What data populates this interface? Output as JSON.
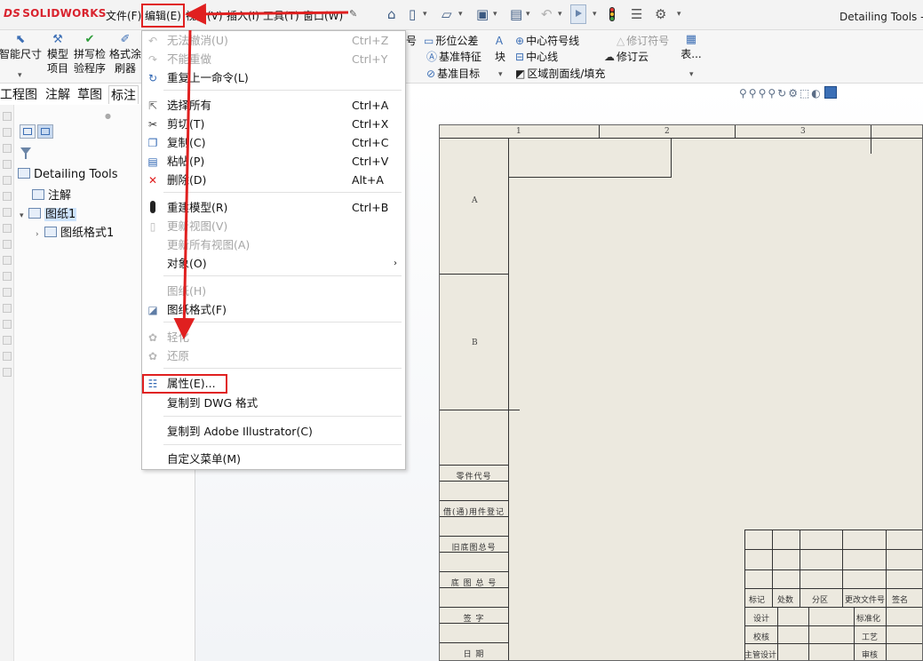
{
  "app": {
    "logo_ds": "DS",
    "logo": "SOLIDWORKS",
    "document_title": "Detailing Tools - 图"
  },
  "menubar": {
    "items": [
      "文件(F)",
      "编辑(E)",
      "视图(V)",
      "插入(I)",
      "工具(T)",
      "窗口(W)"
    ]
  },
  "ribbon": {
    "buttons": [
      {
        "label1": "智能尺寸",
        "label2": ""
      },
      {
        "label1": "模型",
        "label2": "项目"
      },
      {
        "label1": "拼写检",
        "label2": "验程序"
      },
      {
        "label1": "格式涂",
        "label2": "刷器"
      }
    ],
    "group_mid": [
      "号",
      "形位公差",
      "基准特征",
      "基准目标",
      "块"
    ],
    "group_center": [
      "中心符号线",
      "中心线",
      "区域剖面线/填充"
    ],
    "group_right": [
      "修订符号",
      "修订云",
      "表..."
    ]
  },
  "command_tabs": [
    "工程图",
    "注解",
    "草图",
    "标注"
  ],
  "tree": {
    "root": "Detailing Tools",
    "annotations": "注解",
    "sheet": "图纸1",
    "sheet_format": "图纸格式1"
  },
  "edit_menu": {
    "items": [
      {
        "label": "无法撤消(U)",
        "shortcut": "Ctrl+Z",
        "disabled": true
      },
      {
        "label": "不能重做",
        "shortcut": "Ctrl+Y",
        "disabled": true
      },
      {
        "label": "重复上一命令(L)",
        "shortcut": "",
        "disabled": false
      },
      {
        "label": "选择所有",
        "shortcut": "Ctrl+A",
        "disabled": false
      },
      {
        "label": "剪切(T)",
        "shortcut": "Ctrl+X",
        "disabled": false
      },
      {
        "label": "复制(C)",
        "shortcut": "Ctrl+C",
        "disabled": false
      },
      {
        "label": "粘帖(P)",
        "shortcut": "Ctrl+V",
        "disabled": false
      },
      {
        "label": "删除(D)",
        "shortcut": "Alt+A",
        "disabled": false
      },
      {
        "label": "重建模型(R)",
        "shortcut": "Ctrl+B",
        "disabled": false
      },
      {
        "label": "更新视图(V)",
        "shortcut": "",
        "disabled": true
      },
      {
        "label": "更新所有视图(A)",
        "shortcut": "",
        "disabled": true
      },
      {
        "label": "对象(O)",
        "shortcut": "",
        "disabled": false
      },
      {
        "label": "图纸(H)",
        "shortcut": "",
        "disabled": true
      },
      {
        "label": "图纸格式(F)",
        "shortcut": "",
        "disabled": false
      },
      {
        "label": "轻化",
        "shortcut": "",
        "disabled": true
      },
      {
        "label": "还原",
        "shortcut": "",
        "disabled": true
      },
      {
        "label": "属性(E)...",
        "shortcut": "",
        "disabled": false
      },
      {
        "label": "复制到 DWG 格式",
        "shortcut": "",
        "disabled": false
      },
      {
        "label": "复制到 Adobe Illustrator(C)",
        "shortcut": "",
        "disabled": false
      },
      {
        "label": "自定义菜单(M)",
        "shortcut": "",
        "disabled": false
      }
    ]
  },
  "drawing": {
    "zones_top": [
      "1",
      "2",
      "3"
    ],
    "zones_side": [
      "A",
      "B"
    ],
    "side_labels": [
      "零件代号",
      "借(通)用件登记",
      "旧底图总号",
      "底 图 总 号",
      "签    字",
      "日    期"
    ],
    "title_block": {
      "header": [
        "标记",
        "处数",
        "分区",
        "更改文件号",
        "签名"
      ],
      "rows": [
        "设计",
        "校核",
        "主管设计"
      ],
      "right": [
        "标准化",
        "工艺",
        "审核"
      ]
    }
  },
  "colors": {
    "highlight": "#e02020",
    "sheet": "#ece9df",
    "selection": "#cde3fb"
  }
}
